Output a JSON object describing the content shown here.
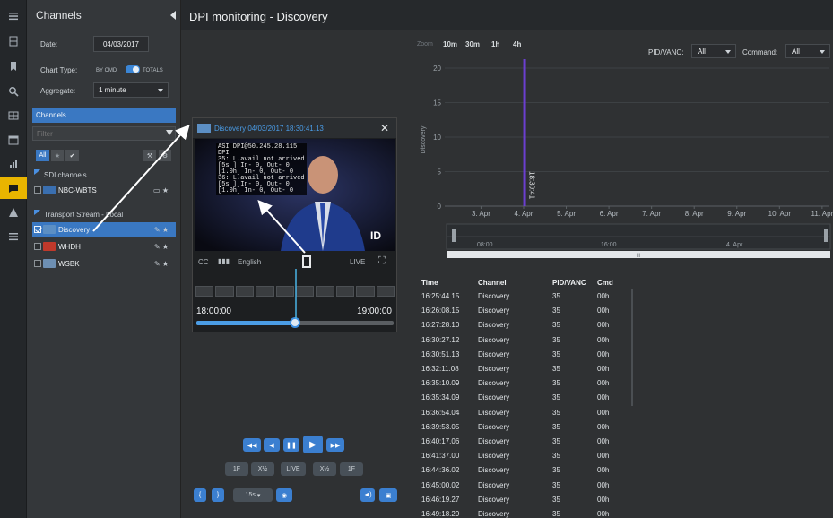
{
  "header": {
    "title": "DPI monitoring - Discovery"
  },
  "sidebar_panel": {
    "title": "Channels",
    "date_label": "Date:",
    "date_value": "04/03/2017",
    "chart_type_label": "Chart Type:",
    "chart_type_left": "BY CMD",
    "chart_type_right": "TOTALS",
    "aggregate_label": "Aggregate:",
    "aggregate_value": "1 minute",
    "channels_header": "Channels",
    "filter_placeholder": "Filter",
    "all_label": "All",
    "groups": [
      {
        "name": "SDI channels",
        "channels": [
          {
            "name": "NBC-WBTS",
            "checked": false
          }
        ]
      },
      {
        "name": "Transport Stream - Local",
        "channels": [
          {
            "name": "Discovery",
            "checked": true,
            "selected": true
          },
          {
            "name": "WHDH",
            "checked": false
          },
          {
            "name": "WSBK",
            "checked": false
          }
        ]
      }
    ]
  },
  "player": {
    "title": "Discovery 04/03/2017 18:30:41.13",
    "overlay_lines": [
      "ASI DPI@50.245.28.115",
      "DPI",
      "35: L.avail not arrived",
      "[5s ] In- 0, Out- 0",
      "[1.0h] In- 0, Out- 0",
      "36: L.avail not arrived",
      "[5s ] In- 0, Out- 0",
      "[1.0h] In- 0, Out- 0"
    ],
    "cc_label": "CC",
    "language_label": "English",
    "live_label": "LIVE",
    "time_start": "18:00:00",
    "time_end": "19:00:00",
    "progress": 0.5,
    "speed_buttons": [
      "1F",
      "X½",
      "LIVE",
      "X½",
      "1F"
    ],
    "step_value": "15s"
  },
  "chart": {
    "zoom_label": "Zoom",
    "zoom_options": [
      "10m",
      "30m",
      "1h",
      "4h"
    ],
    "pid_label": "PID/VANC:",
    "pid_value": "All",
    "command_label": "Command:",
    "command_value": "All",
    "ylabel": "Discovery",
    "cursor_label": "18:30:41",
    "navigator_labels": [
      "08:00",
      "16:00",
      "4. Apr"
    ],
    "navigator_scroll": "III"
  },
  "chart_data": {
    "type": "bar",
    "title": "",
    "xlabel": "",
    "ylabel": "Discovery",
    "ylim": [
      0,
      20
    ],
    "y_ticks": [
      0,
      5,
      10,
      15,
      20
    ],
    "categories": [
      "3. Apr",
      "4. Apr",
      "5. Apr",
      "6. Apr",
      "7. Apr",
      "8. Apr",
      "9. Apr",
      "10. Apr",
      "11. Apr"
    ],
    "series": [
      {
        "values": [
          0,
          23,
          0,
          0,
          0,
          0,
          0,
          0,
          0
        ]
      }
    ],
    "grid": true
  },
  "table": {
    "headers": [
      "Time",
      "Channel",
      "PID/VANC",
      "Cmd"
    ],
    "rows": [
      [
        "16:25:44.15",
        "Discovery",
        "35",
        "00h"
      ],
      [
        "16:26:08.15",
        "Discovery",
        "35",
        "00h"
      ],
      [
        "16:27:28.10",
        "Discovery",
        "35",
        "00h"
      ],
      [
        "16:30:27.12",
        "Discovery",
        "35",
        "00h"
      ],
      [
        "16:30:51.13",
        "Discovery",
        "35",
        "00h"
      ],
      [
        "16:32:11.08",
        "Discovery",
        "35",
        "00h"
      ],
      [
        "16:35:10.09",
        "Discovery",
        "35",
        "00h"
      ],
      [
        "16:35:34.09",
        "Discovery",
        "35",
        "00h"
      ],
      [
        "16:36:54.04",
        "Discovery",
        "35",
        "00h"
      ],
      [
        "16:39:53.05",
        "Discovery",
        "35",
        "00h"
      ],
      [
        "16:40:17.06",
        "Discovery",
        "35",
        "00h"
      ],
      [
        "16:41:37.00",
        "Discovery",
        "35",
        "00h"
      ],
      [
        "16:44:36.02",
        "Discovery",
        "35",
        "00h"
      ],
      [
        "16:45:00.02",
        "Discovery",
        "35",
        "00h"
      ],
      [
        "16:46:19.27",
        "Discovery",
        "35",
        "00h"
      ],
      [
        "16:49:18.29",
        "Discovery",
        "35",
        "00h"
      ]
    ]
  },
  "colors": {
    "accent": "#3b7fd0",
    "rail_active": "#e9b500",
    "bar": "#6b3fd0"
  }
}
